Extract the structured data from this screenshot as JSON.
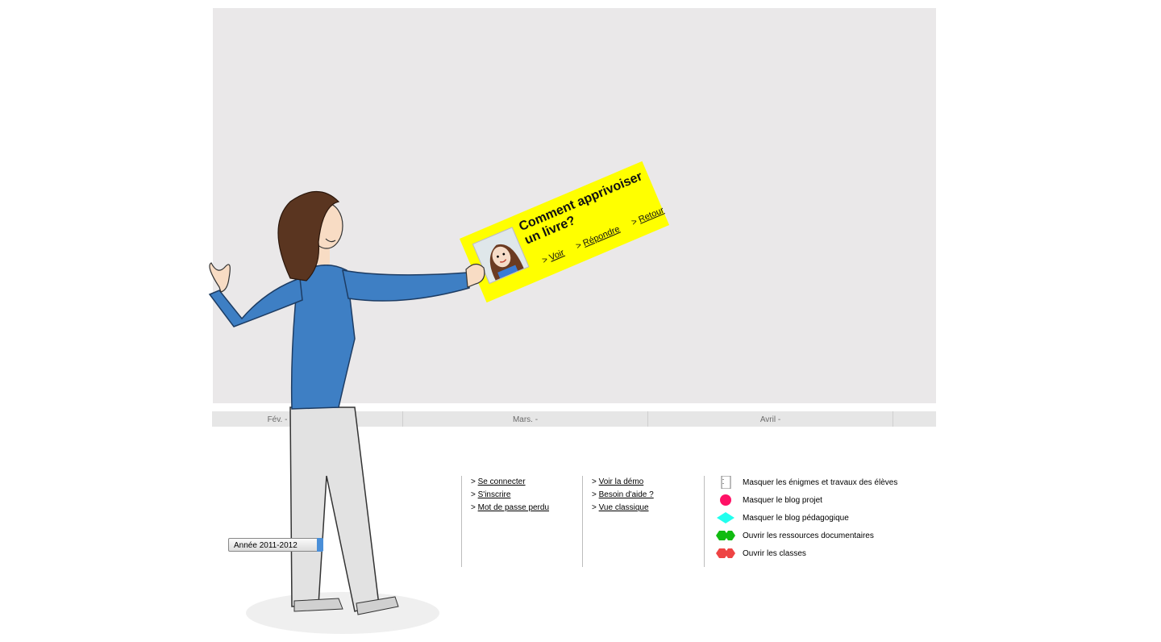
{
  "timeline": {
    "months": [
      {
        "label": "Fév. -"
      },
      {
        "label": "Mars. -"
      },
      {
        "label": "Avril -"
      }
    ]
  },
  "card": {
    "title": "Comment apprivoiser un livre?",
    "links": [
      {
        "prefix": "> ",
        "label": "Voir"
      },
      {
        "prefix": "> ",
        "label": "Répondre"
      },
      {
        "prefix": "> ",
        "label": "Retour"
      }
    ],
    "color": "#ffff00"
  },
  "account_links": [
    {
      "prefix": "> ",
      "label": "Se connecter"
    },
    {
      "prefix": "> ",
      "label": "S'inscrire"
    },
    {
      "prefix": "> ",
      "label": "Mot de passe perdu"
    }
  ],
  "help_links": [
    {
      "prefix": "> ",
      "label": "Voir la démo"
    },
    {
      "prefix": "> ",
      "label": "Besoin d'aide ?"
    },
    {
      "prefix": "> ",
      "label": "Vue classique"
    }
  ],
  "legend": [
    {
      "icon": "notebook-icon",
      "label": "Masquer les énigmes et travaux des élèves",
      "color": "#ffffff"
    },
    {
      "icon": "pink-circle-icon",
      "label": "Masquer le blog projet",
      "color": "#ff1166"
    },
    {
      "icon": "cyan-diamond-icon",
      "label": "Masquer le blog pédagogique",
      "color": "#22ffee"
    },
    {
      "icon": "green-double-hexagon-icon",
      "label": "Ouvrir les ressources documentaires",
      "color": "#11bb11"
    },
    {
      "icon": "red-double-hexagon-icon",
      "label": "Ouvrir les classes",
      "color": "#ee4444"
    }
  ],
  "year_selector": {
    "value": "Année 2011-2012"
  }
}
